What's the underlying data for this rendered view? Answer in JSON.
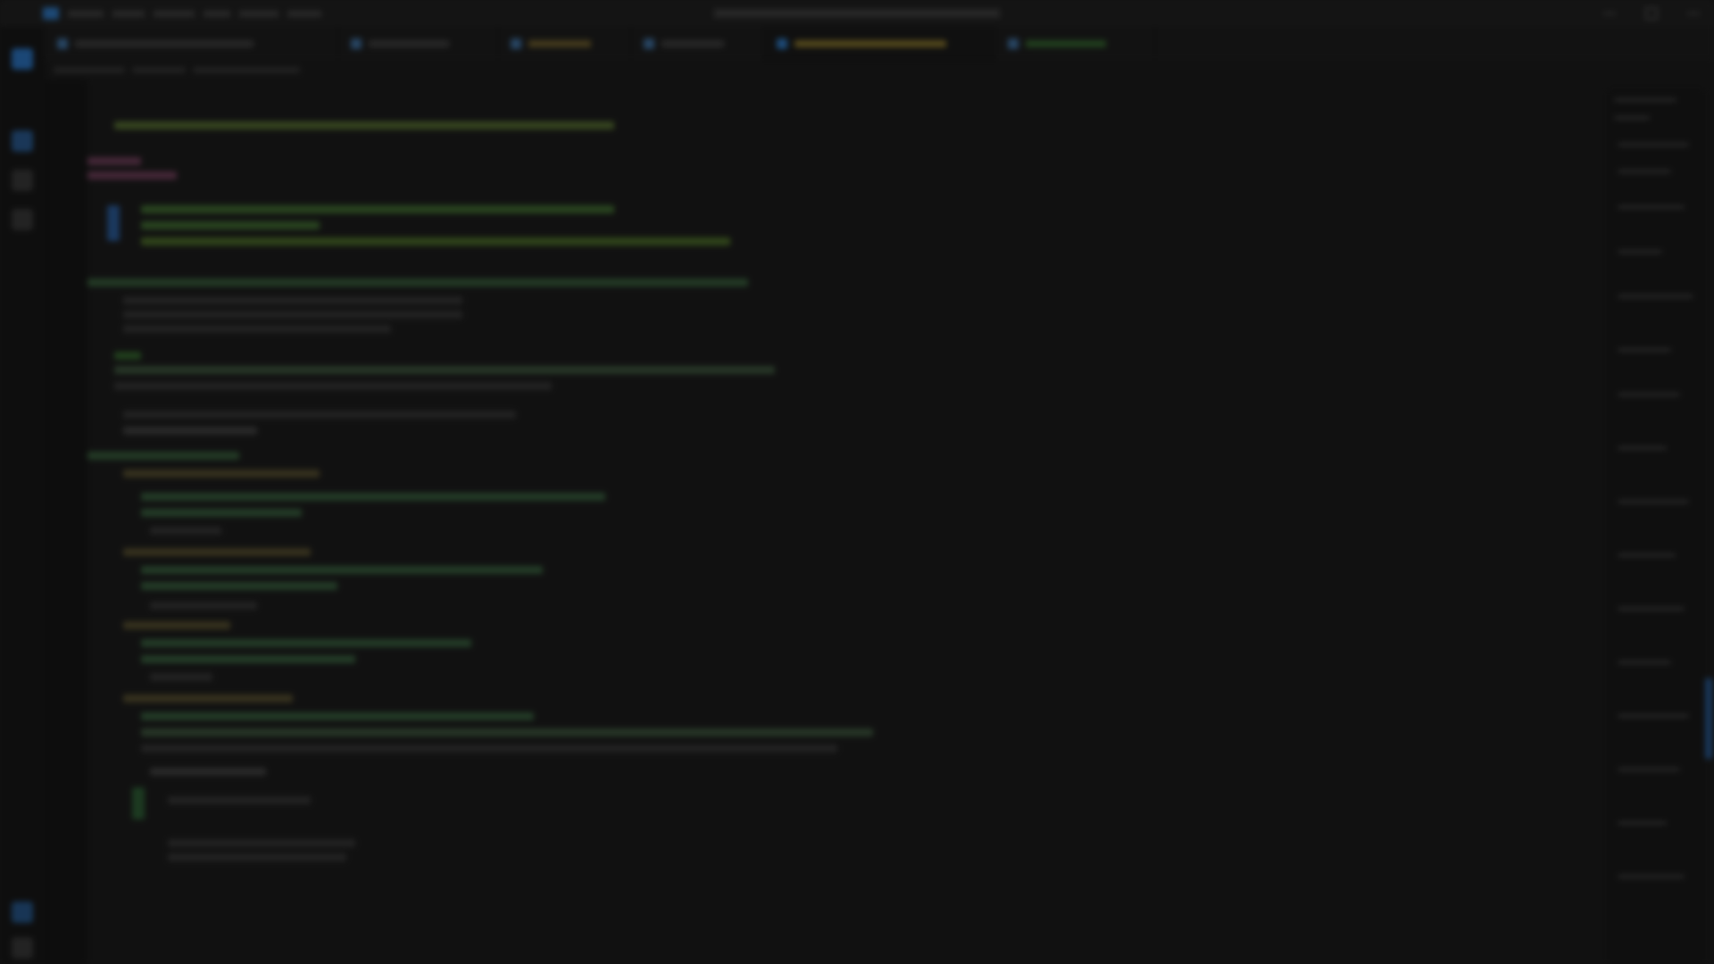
{
  "window": {
    "title": ""
  },
  "tabs": [
    {
      "label": ""
    },
    {
      "label": ""
    },
    {
      "label": ""
    },
    {
      "label": ""
    },
    {
      "label": ""
    },
    {
      "label": ""
    }
  ],
  "breadcrumbs": [
    ""
  ],
  "editor": {
    "content_legible": false
  },
  "colors": {
    "background": "#111111",
    "accent_blue": "#2a6fb0",
    "syntax_green": "#3f7d3a",
    "syntax_yellow": "#8a7a3a",
    "syntax_purple": "#7a4a86",
    "syntax_gray": "#5a5a5a"
  },
  "icons": [
    "explorer-icon",
    "search-icon",
    "source-control-icon",
    "extensions-icon",
    "account-icon",
    "settings-icon"
  ]
}
